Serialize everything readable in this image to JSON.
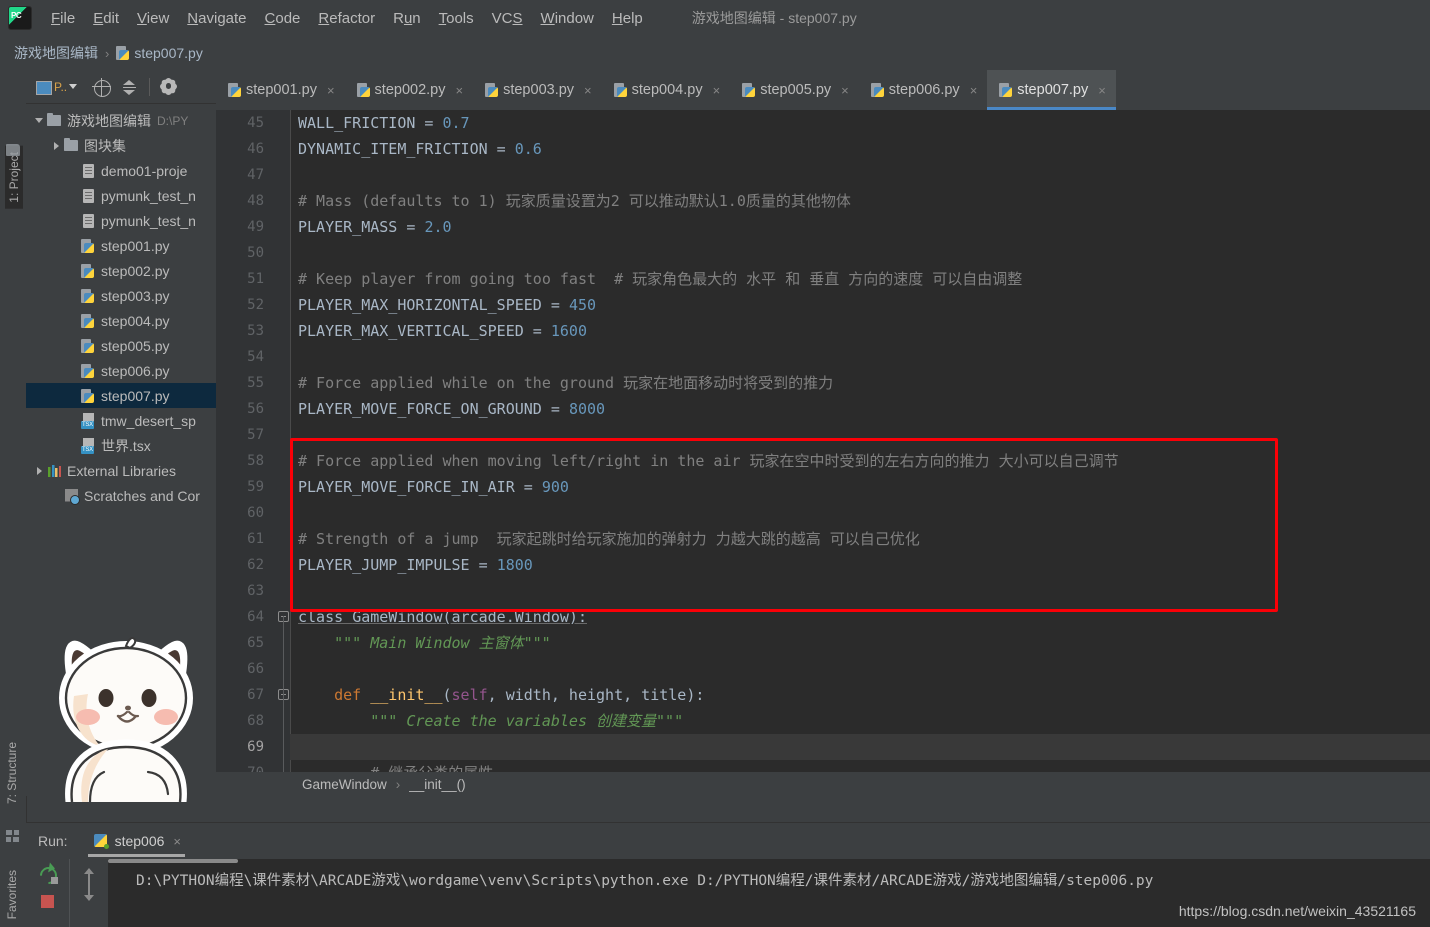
{
  "window": {
    "title": "游戏地图编辑 - step007.py",
    "logo_icon": "pycharm-logo-icon"
  },
  "menubar": {
    "items": [
      {
        "label": "File",
        "mnemonic": "F"
      },
      {
        "label": "Edit",
        "mnemonic": "E"
      },
      {
        "label": "View",
        "mnemonic": "V"
      },
      {
        "label": "Navigate",
        "mnemonic": "N"
      },
      {
        "label": "Code",
        "mnemonic": "C"
      },
      {
        "label": "Refactor",
        "mnemonic": "R"
      },
      {
        "label": "Run",
        "mnemonic": "u"
      },
      {
        "label": "Tools",
        "mnemonic": "T"
      },
      {
        "label": "VCS",
        "mnemonic": "S"
      },
      {
        "label": "Window",
        "mnemonic": "W"
      },
      {
        "label": "Help",
        "mnemonic": "H"
      }
    ]
  },
  "breadcrumb_top": {
    "project": "游戏地图编辑",
    "separator": "›",
    "file": "step007.py"
  },
  "left_strip": {
    "project_label": "1: Project",
    "structure_label": "7: Structure",
    "favorites_label": "Favorites"
  },
  "project_panel": {
    "toolbar": {
      "scope_label": "P..",
      "buttons": [
        "project-scope-selector",
        "locate-target-icon",
        "collapse-all-icon",
        "settings-gear-icon"
      ]
    },
    "tree": [
      {
        "label": "游戏地图编辑",
        "path": "D:\\PY",
        "icon": "folder-icon",
        "arrow": "open",
        "indent": 0,
        "selected": false
      },
      {
        "label": "图块集",
        "path": "",
        "icon": "folder-icon",
        "arrow": "closed",
        "indent": 1,
        "selected": false
      },
      {
        "label": "demo01-proje",
        "path": "",
        "icon": "file-icon",
        "arrow": "none",
        "indent": 2,
        "selected": false
      },
      {
        "label": "pymunk_test_n",
        "path": "",
        "icon": "file-icon",
        "arrow": "none",
        "indent": 2,
        "selected": false
      },
      {
        "label": "pymunk_test_n",
        "path": "",
        "icon": "file-icon",
        "arrow": "none",
        "indent": 2,
        "selected": false
      },
      {
        "label": "step001.py",
        "path": "",
        "icon": "python-file-icon",
        "arrow": "none",
        "indent": 2,
        "selected": false
      },
      {
        "label": "step002.py",
        "path": "",
        "icon": "python-file-icon",
        "arrow": "none",
        "indent": 2,
        "selected": false
      },
      {
        "label": "step003.py",
        "path": "",
        "icon": "python-file-icon",
        "arrow": "none",
        "indent": 2,
        "selected": false
      },
      {
        "label": "step004.py",
        "path": "",
        "icon": "python-file-icon",
        "arrow": "none",
        "indent": 2,
        "selected": false
      },
      {
        "label": "step005.py",
        "path": "",
        "icon": "python-file-icon",
        "arrow": "none",
        "indent": 2,
        "selected": false
      },
      {
        "label": "step006.py",
        "path": "",
        "icon": "python-file-icon",
        "arrow": "none",
        "indent": 2,
        "selected": false
      },
      {
        "label": "step007.py",
        "path": "",
        "icon": "python-file-icon",
        "arrow": "none",
        "indent": 2,
        "selected": true
      },
      {
        "label": "tmw_desert_sp",
        "path": "",
        "icon": "tsx-file-icon",
        "arrow": "none",
        "indent": 2,
        "selected": false
      },
      {
        "label": "世界.tsx",
        "path": "",
        "icon": "tsx-file-icon",
        "arrow": "none",
        "indent": 2,
        "selected": false
      },
      {
        "label": "External Libraries",
        "path": "",
        "icon": "library-icon",
        "arrow": "closed",
        "indent": 0,
        "selected": false
      },
      {
        "label": "Scratches and Cor",
        "path": "",
        "icon": "scratch-icon",
        "arrow": "none",
        "indent": 1,
        "selected": false
      }
    ]
  },
  "editor": {
    "tabs": [
      {
        "label": "step001.py",
        "active": false
      },
      {
        "label": "step002.py",
        "active": false
      },
      {
        "label": "step003.py",
        "active": false
      },
      {
        "label": "step004.py",
        "active": false
      },
      {
        "label": "step005.py",
        "active": false
      },
      {
        "label": "step006.py",
        "active": false
      },
      {
        "label": "step007.py",
        "active": true
      }
    ],
    "close_glyph": "×",
    "accent_color": "#4a88c7",
    "highlight_box_color": "#fb0007",
    "current_line": 69,
    "first_line": 45,
    "code_lines": [
      {
        "n": 45,
        "segments": [
          {
            "t": "WALL_FRICTION = ",
            "c": "c-id"
          },
          {
            "t": "0.7",
            "c": "c-num"
          }
        ]
      },
      {
        "n": 46,
        "segments": [
          {
            "t": "DYNAMIC_ITEM_FRICTION = ",
            "c": "c-id"
          },
          {
            "t": "0.6",
            "c": "c-num"
          }
        ]
      },
      {
        "n": 47,
        "segments": []
      },
      {
        "n": 48,
        "segments": [
          {
            "t": "# Mass (defaults to 1) 玩家质量设置为2 可以推动默认1.0质量的其他物体",
            "c": "c-cmt"
          }
        ]
      },
      {
        "n": 49,
        "segments": [
          {
            "t": "PLAYER_MASS = ",
            "c": "c-id"
          },
          {
            "t": "2.0",
            "c": "c-num"
          }
        ]
      },
      {
        "n": 50,
        "segments": []
      },
      {
        "n": 51,
        "segments": [
          {
            "t": "# Keep player from going too fast  # 玩家角色最大的 水平 和 垂直 方向的速度 可以自由调整",
            "c": "c-cmt"
          }
        ]
      },
      {
        "n": 52,
        "segments": [
          {
            "t": "PLAYER_MAX_HORIZONTAL_SPEED = ",
            "c": "c-id"
          },
          {
            "t": "450",
            "c": "c-num"
          }
        ]
      },
      {
        "n": 53,
        "segments": [
          {
            "t": "PLAYER_MAX_VERTICAL_SPEED = ",
            "c": "c-id"
          },
          {
            "t": "1600",
            "c": "c-num"
          }
        ]
      },
      {
        "n": 54,
        "segments": []
      },
      {
        "n": 55,
        "segments": [
          {
            "t": "# Force applied while on the ground 玩家在地面移动时将受到的推力",
            "c": "c-cmt"
          }
        ]
      },
      {
        "n": 56,
        "segments": [
          {
            "t": "PLAYER_MOVE_FORCE_ON_GROUND = ",
            "c": "c-id"
          },
          {
            "t": "8000",
            "c": "c-num"
          }
        ]
      },
      {
        "n": 57,
        "segments": []
      },
      {
        "n": 58,
        "segments": [
          {
            "t": "# Force applied when moving left/right in the air 玩家在空中时受到的左右方向的推力 大小可以自己调节",
            "c": "c-cmt"
          }
        ]
      },
      {
        "n": 59,
        "segments": [
          {
            "t": "PLAYER_MOVE_FORCE_IN_AIR = ",
            "c": "c-id"
          },
          {
            "t": "900",
            "c": "c-num"
          }
        ]
      },
      {
        "n": 60,
        "segments": []
      },
      {
        "n": 61,
        "segments": [
          {
            "t": "# Strength of a jump  玩家起跳时给玩家施加的弹射力 力越大跳的越高 可以自己优化",
            "c": "c-cmt"
          }
        ]
      },
      {
        "n": 62,
        "segments": [
          {
            "t": "PLAYER_JUMP_IMPULSE = ",
            "c": "c-id"
          },
          {
            "t": "1800",
            "c": "c-num"
          }
        ]
      },
      {
        "n": 63,
        "segments": []
      },
      {
        "n": 64,
        "segments": [
          {
            "t": "class ",
            "c": "c-kw c-cls"
          },
          {
            "t": "GameWindow",
            "c": "c-def c-cls"
          },
          {
            "t": "(arcade.Window):",
            "c": "c-id c-cls"
          }
        ]
      },
      {
        "n": 65,
        "segments": [
          {
            "t": "    \"\"\" Main Window 主窗体\"\"\"",
            "c": "c-str"
          }
        ]
      },
      {
        "n": 66,
        "segments": []
      },
      {
        "n": 67,
        "segments": [
          {
            "t": "    def ",
            "c": "c-kw"
          },
          {
            "t": "__init__",
            "c": "c-def"
          },
          {
            "t": "(",
            "c": "c-id"
          },
          {
            "t": "self",
            "c": "c-self"
          },
          {
            "t": ", width, height, title):",
            "c": "c-id"
          }
        ]
      },
      {
        "n": 68,
        "segments": [
          {
            "t": "        \"\"\" Create the variables 创建变量\"\"\"",
            "c": "c-str"
          }
        ]
      },
      {
        "n": 69,
        "segments": []
      },
      {
        "n": 70,
        "segments": [
          {
            "t": "        # 继承父类的属性",
            "c": "c-cmt"
          }
        ]
      }
    ],
    "breadcrumb_bottom": {
      "class": "GameWindow",
      "separator": "›",
      "method": "__init__()"
    }
  },
  "run_panel": {
    "label": "Run:",
    "tab_name": "step006",
    "close_glyph": "×",
    "console_output": "D:\\PYTHON编程\\课件素材\\ARCADE游戏\\wordgame\\venv\\Scripts\\python.exe D:/PYTHON编程/课件素材/ARCADE游戏/游戏地图编辑/step006.py",
    "actions": [
      "rerun-icon",
      "stop-icon",
      "scroll-up-icon",
      "scroll-down-icon"
    ]
  },
  "watermark": {
    "text": "https://blog.csdn.net/weixin_43521165"
  }
}
